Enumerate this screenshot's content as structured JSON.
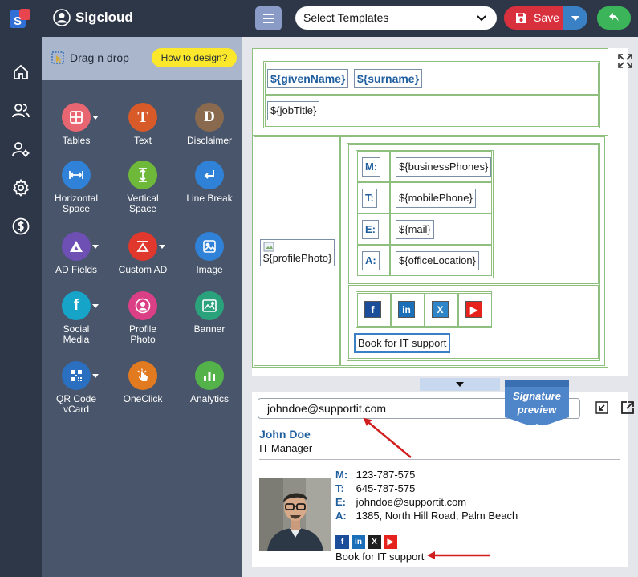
{
  "app": {
    "brand": "Sigcloud",
    "colors": {
      "primary": "#2d3748",
      "accent": "#d9303d",
      "link": "#1f5e9f"
    }
  },
  "rail": {
    "items": [
      {
        "icon": "home-icon"
      },
      {
        "icon": "users-icon"
      },
      {
        "icon": "user-settings-icon"
      },
      {
        "icon": "gear-icon"
      },
      {
        "icon": "dollar-icon"
      }
    ]
  },
  "panel": {
    "drag_label": "Drag n drop",
    "how_to_label": "How to design?",
    "tools": [
      {
        "label": "Tables",
        "label2": "",
        "icon": "table-icon",
        "color": "#e86671",
        "dropdown": true
      },
      {
        "label": "Text",
        "label2": "",
        "icon": "text-icon",
        "color": "#d85a28",
        "dropdown": false
      },
      {
        "label": "Disclaimer",
        "label2": "",
        "icon": "disclaimer-icon",
        "color": "#8a6a4e",
        "dropdown": false
      },
      {
        "label": "Horizontal",
        "label2": "Space",
        "icon": "horizontal-space-icon",
        "color": "#2f82d8",
        "dropdown": false
      },
      {
        "label": "Vertical",
        "label2": "Space",
        "icon": "vertical-space-icon",
        "color": "#6fb93a",
        "dropdown": false
      },
      {
        "label": "Line Break",
        "label2": "",
        "icon": "line-break-icon",
        "color": "#2f82d8",
        "dropdown": false
      },
      {
        "label": "AD Fields",
        "label2": "",
        "icon": "ad-fields-icon",
        "color": "#6e4fb4",
        "dropdown": true
      },
      {
        "label": "Custom AD",
        "label2": "",
        "icon": "custom-ad-icon",
        "color": "#e0382c",
        "dropdown": true
      },
      {
        "label": "Image",
        "label2": "",
        "icon": "image-icon",
        "color": "#2f82d8",
        "dropdown": false
      },
      {
        "label": "Social",
        "label2": "Media",
        "icon": "facebook-icon",
        "color": "#16a5c9",
        "dropdown": true
      },
      {
        "label": "Profile",
        "label2": "Photo",
        "icon": "profile-photo-icon",
        "color": "#db3f86",
        "dropdown": false
      },
      {
        "label": "Banner",
        "label2": "",
        "icon": "banner-icon",
        "color": "#2aa37d",
        "dropdown": false
      },
      {
        "label": "QR Code",
        "label2": "vCard",
        "icon": "qr-code-icon",
        "color": "#2a6fc0",
        "dropdown": true
      },
      {
        "label": "OneClick",
        "label2": "",
        "icon": "one-click-icon",
        "color": "#e27a1f",
        "dropdown": false
      },
      {
        "label": "Analytics",
        "label2": "",
        "icon": "analytics-icon",
        "color": "#53b24a",
        "dropdown": false
      }
    ]
  },
  "toolbar": {
    "template_select": "Select Templates",
    "save_label": "Save"
  },
  "editor": {
    "given_name": "${givenName}",
    "surname": "${surname}",
    "job_title": "${jobTitle}",
    "profile_photo": "${profilePhoto}",
    "contacts": [
      {
        "key": "M:",
        "value": "${businessPhones}"
      },
      {
        "key": "T:",
        "value": "${mobilePhone}"
      },
      {
        "key": "E:",
        "value": "${mail}"
      },
      {
        "key": "A:",
        "value": "${officeLocation}"
      }
    ],
    "social": [
      {
        "icon": "facebook-icon",
        "glyph": "f",
        "color": "#1b4d9a"
      },
      {
        "icon": "linkedin-icon",
        "glyph": "in",
        "color": "#1b6fb8"
      },
      {
        "icon": "x-icon",
        "glyph": "X",
        "color": "#2e86c9"
      },
      {
        "icon": "youtube-icon",
        "glyph": "▶",
        "color": "#e5221c"
      }
    ],
    "cta": "Book for IT support"
  },
  "preview": {
    "ribbon_line1": "Signature",
    "ribbon_line2": "preview",
    "email_value": "johndoe@supportit.com",
    "name": "John Doe",
    "title": "IT Manager",
    "contacts": [
      {
        "key": "M:",
        "value": "123-787-575"
      },
      {
        "key": "T:",
        "value": "645-787-575"
      },
      {
        "key": "E:",
        "value": "johndoe@supportit.com"
      },
      {
        "key": "A:",
        "value": "1385, North Hill Road, Palm Beach"
      }
    ],
    "social": [
      {
        "icon": "facebook-icon",
        "glyph": "f",
        "color": "#1b4d9a"
      },
      {
        "icon": "linkedin-icon",
        "glyph": "in",
        "color": "#1b6fb8"
      },
      {
        "icon": "x-icon",
        "glyph": "X",
        "color": "#1f1f1f"
      },
      {
        "icon": "youtube-icon",
        "glyph": "▶",
        "color": "#e5221c"
      }
    ],
    "cta": "Book for IT support"
  }
}
